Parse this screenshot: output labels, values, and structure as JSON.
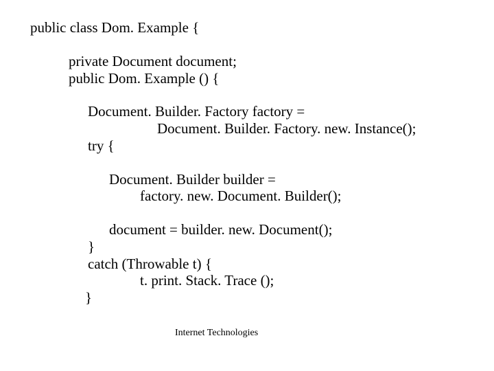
{
  "code": {
    "l1": "public class Dom. Example {",
    "l2": "private Document document;",
    "l3": "public Dom. Example () {",
    "l4": "Document. Builder. Factory factory =",
    "l5": "Document. Builder. Factory. new. Instance();",
    "l6": "try {",
    "l7": "Document. Builder builder =",
    "l8": "factory. new. Document. Builder();",
    "l9": "document = builder. new. Document();",
    "l10": "}",
    "l11": "catch (Throwable t) {",
    "l12": "t. print. Stack. Trace ();",
    "l13": "}"
  },
  "footnote": "Internet Technologies"
}
